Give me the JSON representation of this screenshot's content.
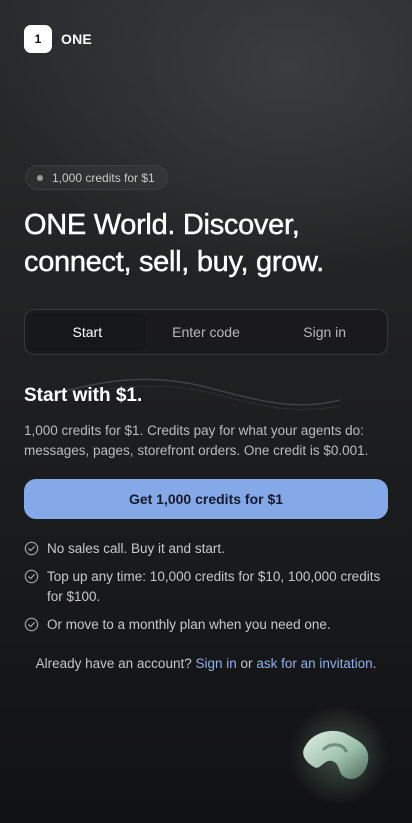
{
  "header": {
    "logo_text": "1",
    "brand": "ONE"
  },
  "badge": {
    "text": "1,000 credits for $1"
  },
  "hero": {
    "headline": "ONE World. Discover, connect, sell, buy, grow."
  },
  "tabs": [
    {
      "label": "Start",
      "active": true
    },
    {
      "label": "Enter code",
      "active": false
    },
    {
      "label": "Sign in",
      "active": false
    }
  ],
  "section": {
    "title": "Start with $1.",
    "description": "1,000 credits for $1. Credits pay for what your agents do: messages, pages, storefront orders. One credit is $0.001."
  },
  "cta": {
    "label": "Get 1,000 credits for $1",
    "color": "#84a8e8"
  },
  "checklist": [
    {
      "text": "No sales call. Buy it and start.",
      "icon": "check-circle-icon"
    },
    {
      "text": "Top up any time: 10,000 credits for $10, 100,000 credits for $100.",
      "icon": "check-circle-icon"
    },
    {
      "text": "Or move to a monthly plan when you need one.",
      "icon": "check-circle-icon"
    }
  ],
  "footer": {
    "prefix": "Already have an account?",
    "signin_link": "Sign in",
    "middle": "or",
    "invite_link": "ask for an invitation",
    "suffix": "."
  },
  "colors": {
    "accent": "#84a8e8",
    "link": "#8fb0ec",
    "background": "#1c1d1f"
  }
}
